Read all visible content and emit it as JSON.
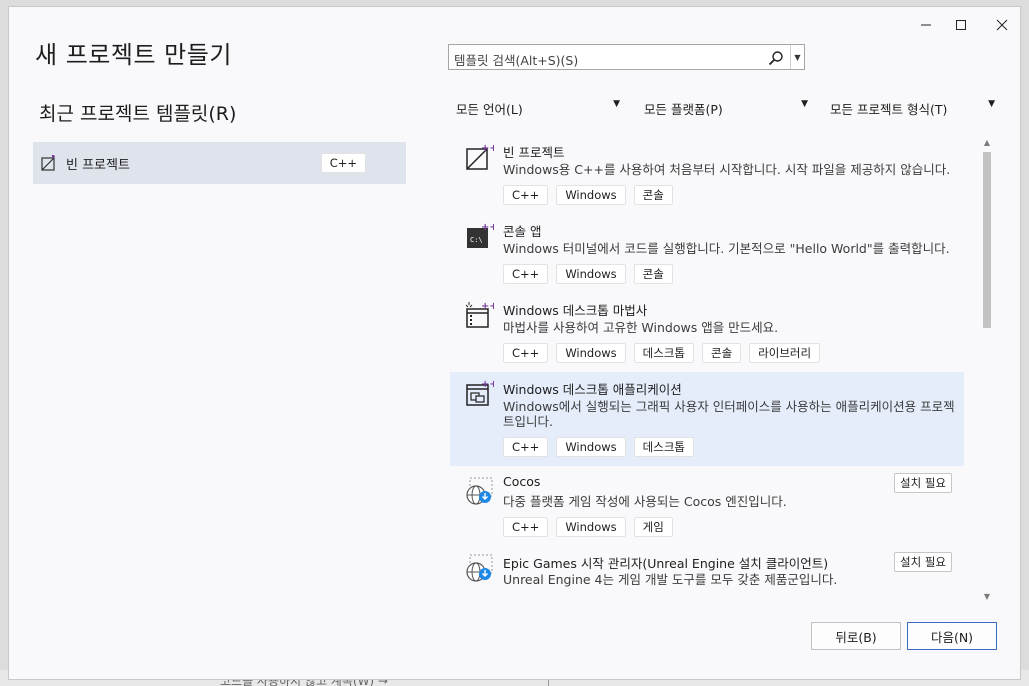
{
  "window": {
    "minimize_label": "—",
    "maximize_label": "☐",
    "close_label": "✕"
  },
  "page_title": "새 프로젝트 만들기",
  "recent": {
    "title": "최근 프로젝트 템플릿(R)",
    "items": [
      {
        "label": "빈 프로젝트",
        "tag": "C++",
        "icon": "empty-project-icon"
      }
    ]
  },
  "search": {
    "placeholder": "템플릿 검색(Alt+S)(S)"
  },
  "filters": {
    "language": "모든 언어(L)",
    "platform": "모든 플랫폼(P)",
    "project_type": "모든 프로젝트 형식(T)"
  },
  "templates": [
    {
      "name": "빈 프로젝트",
      "description": "Windows용 C++를 사용하여 처음부터 시작합니다. 시작 파일을 제공하지 않습니다.",
      "tags": [
        "C++",
        "Windows",
        "콘솔"
      ],
      "icon": "empty-project-icon",
      "selected": false
    },
    {
      "name": "콘솔 앱",
      "description": "Windows 터미널에서 코드를 실행합니다. 기본적으로 \"Hello World\"를 출력합니다.",
      "tags": [
        "C++",
        "Windows",
        "콘솔"
      ],
      "icon": "console-app-icon",
      "selected": false
    },
    {
      "name": "Windows 데스크톱 마법사",
      "description": "마법사를 사용하여 고유한 Windows 앱을 만드세요.",
      "tags": [
        "C++",
        "Windows",
        "데스크톱",
        "콘솔",
        "라이브러리"
      ],
      "icon": "desktop-wizard-icon",
      "selected": false
    },
    {
      "name": "Windows 데스크톱 애플리케이션",
      "description": "Windows에서 실행되는 그래픽 사용자 인터페이스를 사용하는 애플리케이션용 프로젝트입니다.",
      "tags": [
        "C++",
        "Windows",
        "데스크톱"
      ],
      "icon": "desktop-app-icon",
      "selected": true
    },
    {
      "name": "Cocos",
      "description": "다중 플랫폼 게임 작성에 사용되는 Cocos 엔진입니다.",
      "tags": [
        "C++",
        "Windows",
        "게임"
      ],
      "icon": "download-globe-icon",
      "badge": "설치 필요",
      "selected": false
    },
    {
      "name": "Epic Games 시작 관리자(Unreal Engine 설치 클라이언트)",
      "description": "Unreal Engine 4는 게임 개발 도구를 모두 갖춘 제품군입니다.",
      "tags": [],
      "icon": "download-globe-icon",
      "badge": "설치 필요",
      "selected": false
    }
  ],
  "buttons": {
    "back": "뒤로(B)",
    "next": "다음(N)"
  },
  "background_text": "코드를 사용하지 않고 계속(W) →",
  "colors": {
    "accent": "#3d6cc4",
    "selected_bg": "#e5edfb",
    "recent_bg": "#dfe3ec",
    "vs_purple": "#7b3fa0",
    "download_blue": "#1e88e5"
  }
}
